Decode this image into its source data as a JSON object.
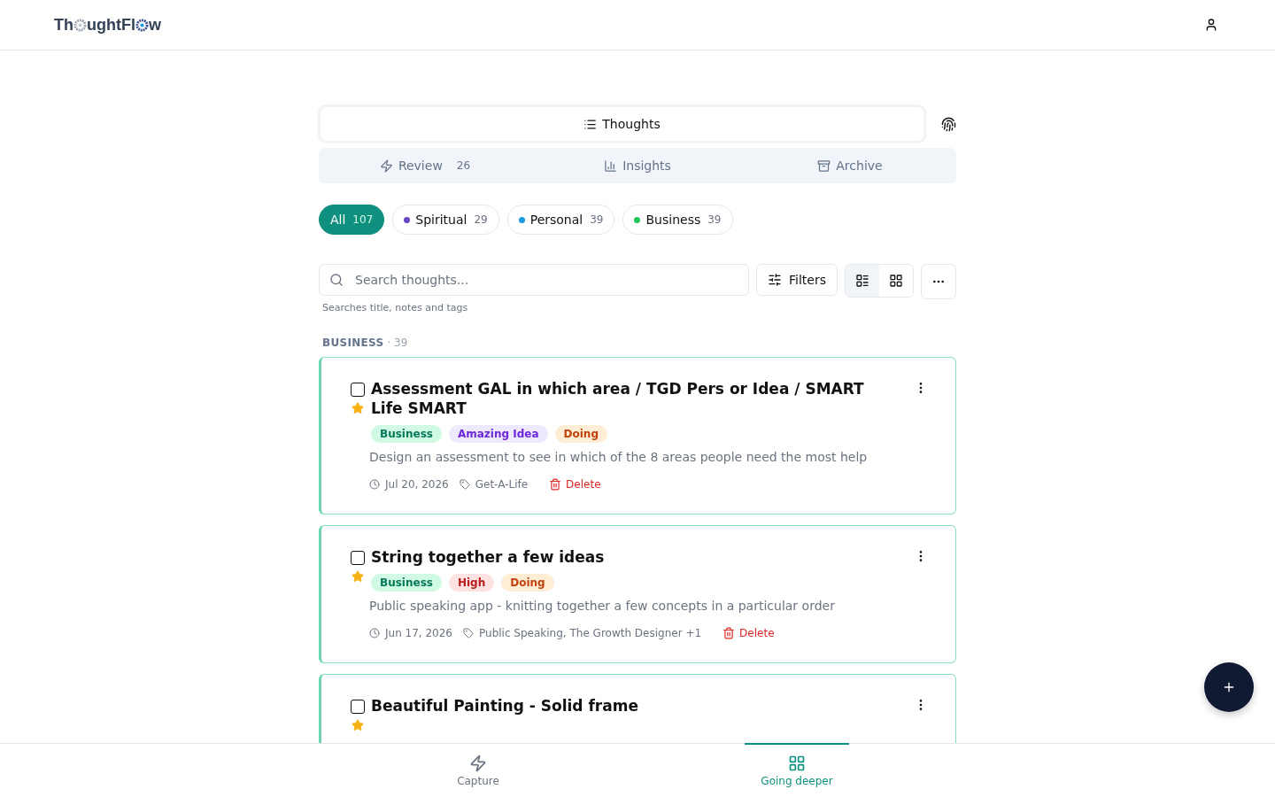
{
  "header": {
    "logo_parts": [
      "Th",
      "ughtFl",
      "w"
    ]
  },
  "view_tab": {
    "label": "Thoughts",
    "selected": true
  },
  "sub_tabs": [
    {
      "label": "Review",
      "count": "26",
      "selected": false
    },
    {
      "label": "Insights",
      "selected": false
    },
    {
      "label": "Archive",
      "selected": false
    }
  ],
  "filters": [
    {
      "label": "All",
      "count": "107",
      "selected": true
    },
    {
      "label": "Spiritual",
      "count": "29",
      "color": "#6b46c1",
      "selected": false
    },
    {
      "label": "Personal",
      "count": "39",
      "color": "#1e9be0",
      "selected": false
    },
    {
      "label": "Business",
      "count": "39",
      "color": "#22c55e",
      "selected": false
    }
  ],
  "search": {
    "placeholder": "Search thoughts...",
    "hint": "Searches title, notes and tags"
  },
  "toolbar": {
    "filters_label": "Filters",
    "view_buttons": [
      {
        "selected": true
      },
      {
        "selected": false
      }
    ]
  },
  "section": {
    "title": "BUSINESS",
    "count": "· 39"
  },
  "cards": [
    {
      "title": "Assessment GAL in which area / TGD Pers or Idea / SMART Life SMART",
      "checked": false,
      "starred": true,
      "tags": [
        {
          "label": "Business",
          "kind": "category"
        },
        {
          "label": "Amazing Idea",
          "kind": "idea"
        },
        {
          "label": "Doing",
          "kind": "status"
        }
      ],
      "note": "Design an assessment to see in which of the 8 areas people need the most help",
      "date": "Jul 20, 2026",
      "labels": "Get-A-Life",
      "delete": "Delete"
    },
    {
      "title": "String together a few ideas",
      "checked": false,
      "starred": true,
      "tags": [
        {
          "label": "Business",
          "kind": "category"
        },
        {
          "label": "High",
          "kind": "priority"
        },
        {
          "label": "Doing",
          "kind": "status"
        }
      ],
      "note": "Public speaking app - knitting together a few concepts in a particular order",
      "date": "Jun 17, 2026",
      "labels": "Public Speaking, The Growth Designer +1",
      "delete": "Delete"
    },
    {
      "title": "Beautiful Painting - Solid frame",
      "checked": false,
      "starred": true
    }
  ],
  "bottom_nav": [
    {
      "label": "Capture",
      "selected": false
    },
    {
      "label": "Going deeper",
      "selected": true
    }
  ]
}
